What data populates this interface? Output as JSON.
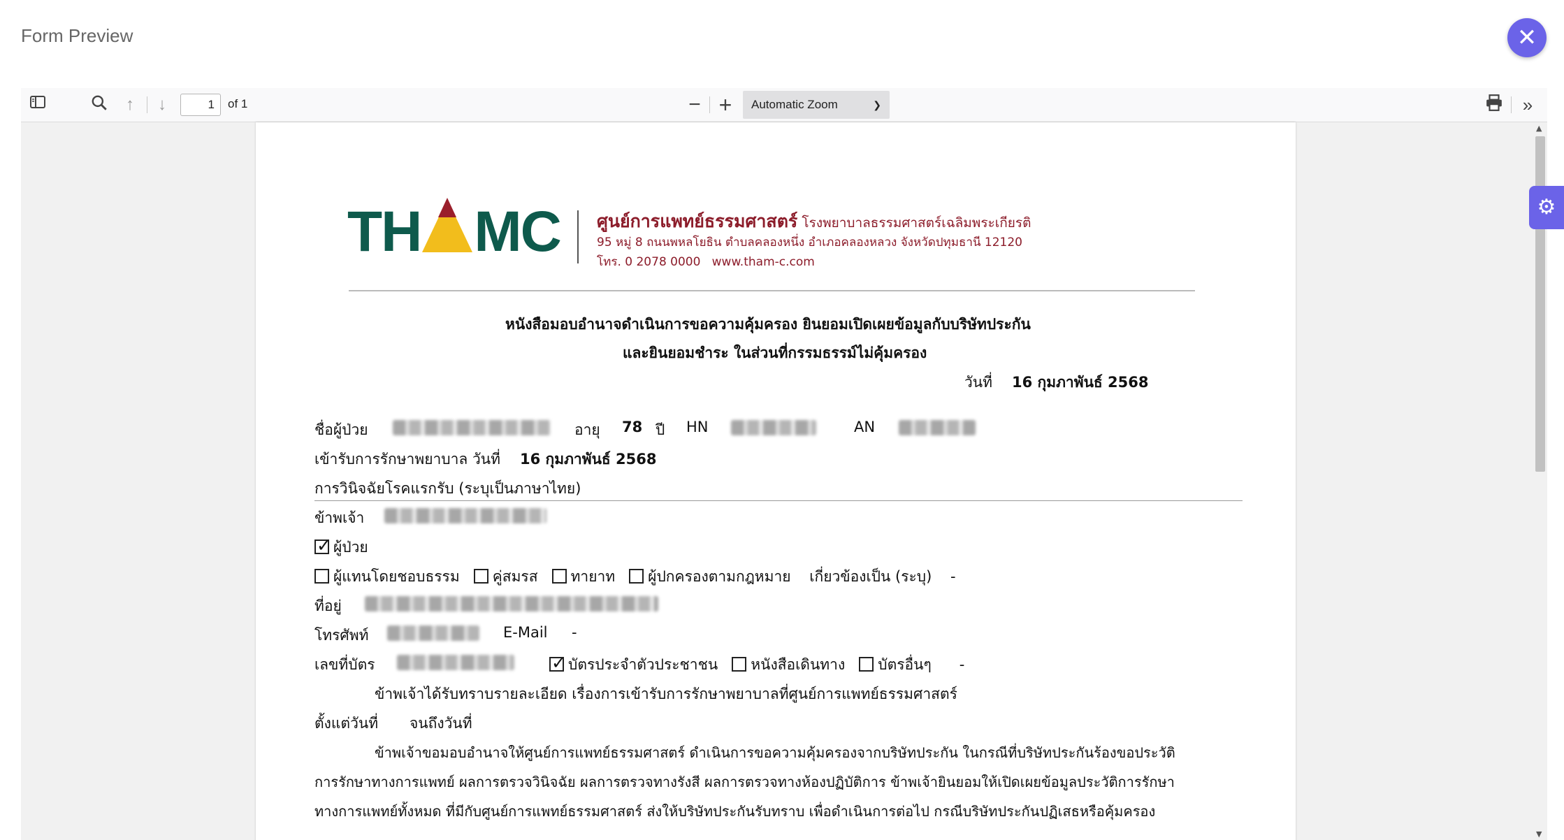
{
  "header": {
    "title": "Form Preview",
    "close_icon": "close-icon"
  },
  "toolbar": {
    "page_number": "1",
    "page_of": "of 1",
    "zoom": "Automatic Zoom",
    "zoom_minus": "−",
    "zoom_plus": "+"
  },
  "letterhead": {
    "logo_text_left": "TH",
    "logo_text_right": "MC",
    "hospital_name": "ศูนย์การแพทย์ธรรมศาสตร์",
    "hospital_sub": "โรงพยาบาลธรรมศาสตร์เฉลิมพระเกียรติ",
    "address": "95 หมู่ 8 ถนนพหลโยธิน ตำบลคลองหนึ่ง อำเภอคลองหลวง จังหวัดปทุมธานี 12120",
    "phone": "โทร. 0 2078 0000",
    "website": "www.tham-c.com"
  },
  "document": {
    "title_line1": "หนังสือมอบอำนาจดำเนินการขอความคุ้มครอง ยินยอมเปิดเผยข้อมูลกับบริษัทประกัน",
    "title_line2": "และยินยอมชำระ ในส่วนที่กรรมธรรม์ไม่คุ้มครอง",
    "date_label": "วันที่",
    "date_value": "16 กุมภาพันธ์ 2568",
    "patient_label": "ชื่อผู้ป่วย",
    "age_label": "อายุ",
    "age_value": "78",
    "age_unit": "ปี",
    "hn_label": "HN",
    "an_label": "AN",
    "admit_label": "เข้ารับการรักษาพยาบาล วันที่",
    "admit_value": "16 กุมภาพันธ์ 2568",
    "diagnosis_label": "การวินิจฉัยโรคแรกรับ (ระบุเป็นภาษาไทย)",
    "grantor_label": "ข้าพเจ้า",
    "role_patient": "ผู้ป่วย",
    "role_rep": "ผู้แทนโดยชอบธรรม",
    "role_spouse": "คู่สมรส",
    "role_heir": "ทายาท",
    "role_guardian": "ผู้ปกครองตามกฎหมาย",
    "relation_label": "เกี่ยวข้องเป็น (ระบุ)",
    "relation_value": "-",
    "address_label": "ที่อยู่",
    "phone_label": "โทรศัพท์",
    "email_label": "E-Mail",
    "email_value": "-",
    "id_label": "เลขที่บัตร",
    "id_type_citizen": "บัตรประจำตัวประชาชน",
    "id_type_passport": "หนังสือเดินทาง",
    "id_type_other": "บัตรอื่นๆ",
    "id_other_value": "-",
    "para1": "ข้าพเจ้าได้รับทราบรายละเอียด เรื่องการเข้ารับการรักษาพยาบาลที่ศูนย์การแพทย์ธรรมศาสตร์",
    "since_label": "ตั้งแต่วันที่",
    "until_label": "จนถึงวันที่",
    "para2_l1": "ข้าพเจ้าขอมอบอำนาจให้ศูนย์การแพทย์ธรรมศาสตร์ ดำเนินการขอความคุ้มครองจากบริษัทประกัน ในกรณีที่บริษัทประกันร้องขอประวัติ",
    "para2_l2": "การรักษาทางการแพทย์ ผลการตรวจวินิจฉัย ผลการตรวจทางรังสี ผลการตรวจทางห้องปฏิบัติการ ข้าพเจ้ายินยอมให้เปิดเผยข้อมูลประวัติการรักษา",
    "para2_l3": "ทางการแพทย์ทั้งหมด ที่มีกับศูนย์การแพทย์ธรรมศาสตร์ ส่งให้บริษัทประกันรับทราบ เพื่อดำเนินการต่อไป กรณีบริษัทประกันปฏิเสธหรือคุ้มครอง"
  }
}
